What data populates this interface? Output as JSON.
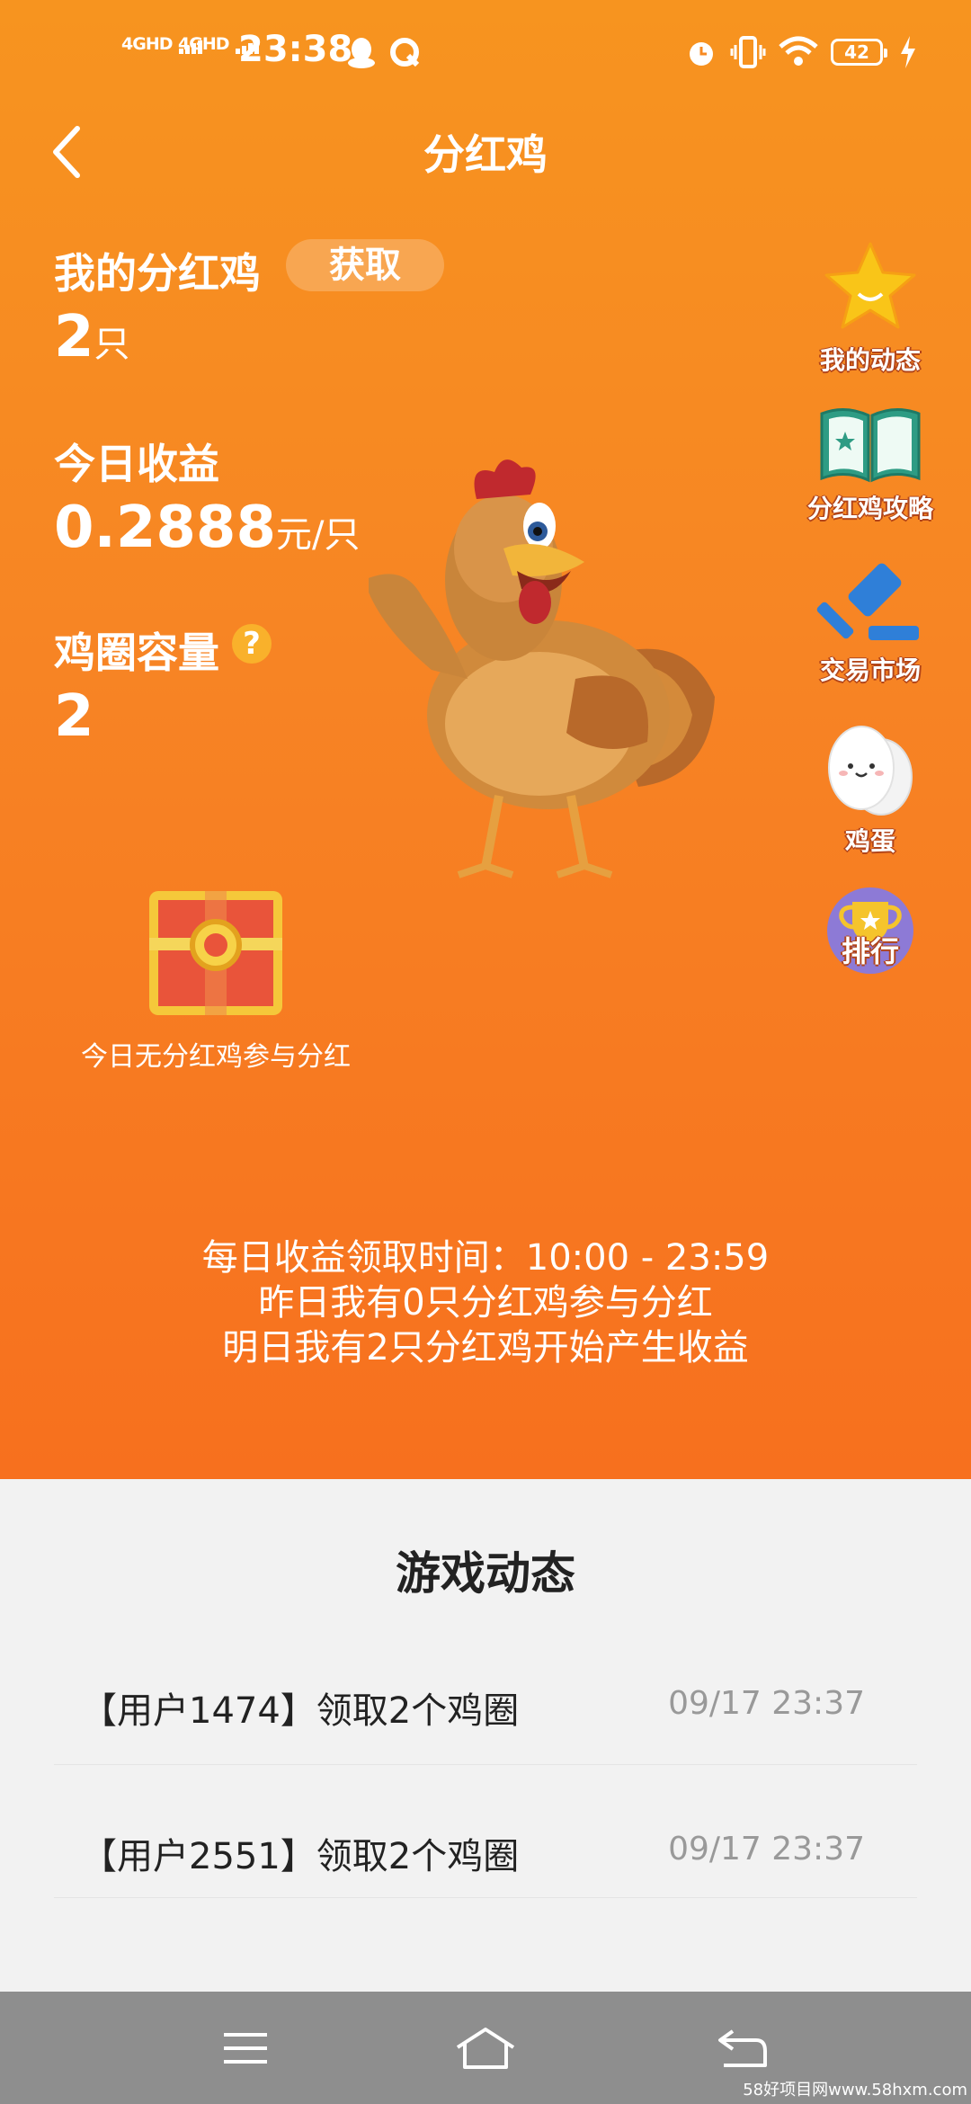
{
  "status_bar": {
    "signal1": "4GHD",
    "signal2": "4GHD",
    "time": "23:38",
    "battery": "42"
  },
  "header": {
    "title": "分红鸡"
  },
  "stats": {
    "my_chickens_label": "我的分红鸡",
    "get_button": "获取",
    "my_chickens_value": "2",
    "my_chickens_unit": "只",
    "today_income_label": "今日收益",
    "today_income_value": "0.2888",
    "today_income_unit": "元/只",
    "coop_capacity_label": "鸡圈容量",
    "coop_help": "?",
    "coop_capacity_value": "2"
  },
  "side_menu": [
    {
      "label": "我的动态",
      "icon": "star-icon"
    },
    {
      "label": "分红鸡攻略",
      "icon": "book-icon"
    },
    {
      "label": "交易市场",
      "icon": "gavel-icon"
    },
    {
      "label": "鸡蛋",
      "icon": "egg-icon"
    },
    {
      "label": "排行",
      "icon": "trophy-icon"
    }
  ],
  "chest": {
    "caption": "今日无分红鸡参与分红"
  },
  "info": {
    "line1": "每日收益领取时间：10:00 - 23:59",
    "line2": "昨日我有0只分红鸡参与分红",
    "line3": "明日我有2只分红鸡开始产生收益"
  },
  "feed": {
    "title": "游戏动态",
    "rows": [
      {
        "text": "【用户1474】领取2个鸡圈",
        "time": "09/17 23:37"
      },
      {
        "text": "【用户2551】领取2个鸡圈",
        "time": "09/17 23:37"
      }
    ]
  },
  "watermark": "58好项目网www.58hxm.com",
  "colors": {
    "accent": "#f78a22",
    "panel": "#f2f2f2",
    "navbar": "#8e8e8e"
  }
}
